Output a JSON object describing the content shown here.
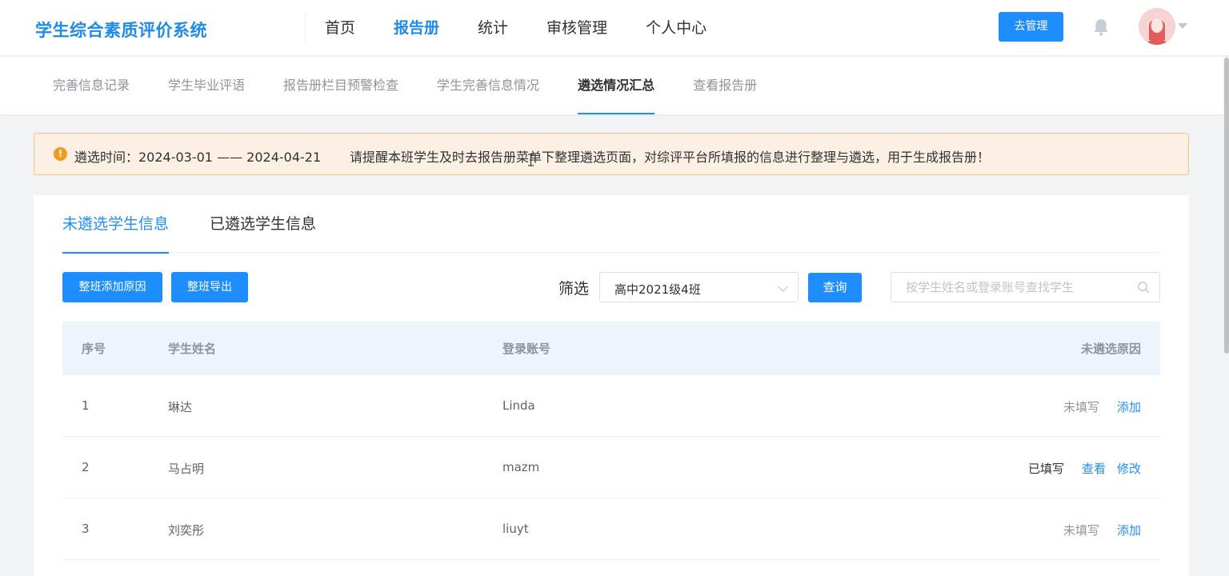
{
  "header": {
    "logo": "学生综合素质评价系统",
    "nav": [
      "首页",
      "报告册",
      "统计",
      "审核管理",
      "个人中心"
    ],
    "active_nav": "报告册",
    "manage_button": "去管理",
    "bell_icon": "bell-icon",
    "avatar_icon": "user-avatar-icon"
  },
  "subnav": {
    "items": [
      "完善信息记录",
      "学生毕业评语",
      "报告册栏目预警检查",
      "学生完善信息情况",
      "遴选情况汇总",
      "查看报告册"
    ],
    "active": "遴选情况汇总"
  },
  "notice": {
    "icon": "warning-icon",
    "time": "遴选时间：2024-03-01 —— 2024-04-21",
    "message": "请提醒本班学生及时去报告册菜单下整理遴选页面，对综评平台所填报的信息进行整理与遴选，用于生成报告册！"
  },
  "tabs": {
    "unselected": "未遴选学生信息",
    "selected": "已遴选学生信息"
  },
  "toolbar": {
    "add_reason": "整班添加原因",
    "export": "整班导出",
    "filter_label": "筛选",
    "class_select": "高中2021级4班",
    "query": "查询",
    "search_placeholder": "按学生姓名或登录账号查找学生"
  },
  "table": {
    "headers": {
      "index": "序号",
      "name": "学生姓名",
      "account": "登录账号",
      "reason": "未遴选原因"
    },
    "rows": [
      {
        "index": "1",
        "name": "琳达",
        "account": "Linda",
        "status": "未填写",
        "actions": [
          "添加"
        ]
      },
      {
        "index": "2",
        "name": "马占明",
        "account": "mazm",
        "status": "已填写",
        "actions": [
          "查看",
          "修改"
        ]
      },
      {
        "index": "3",
        "name": "刘奕彤",
        "account": "liuyt",
        "status": "未填写",
        "actions": [
          "添加"
        ]
      }
    ]
  },
  "colors": {
    "primary": "#1e8eff",
    "logo": "#1e8bea",
    "notice_bg": "#fbf0e3",
    "notice_border": "#f5c57f",
    "warning": "#f29b1f",
    "table_header_bg": "#eef4fb"
  }
}
